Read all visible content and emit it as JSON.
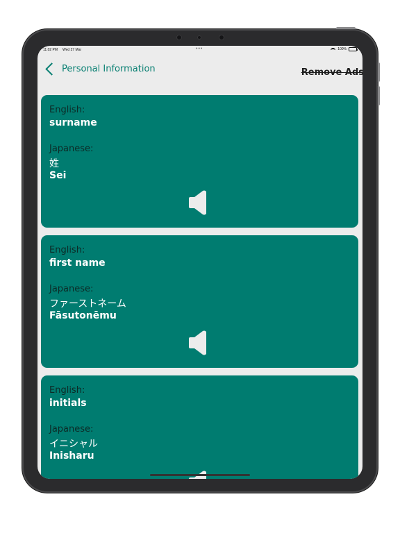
{
  "status_bar": {
    "time": "11:02 PM",
    "date": "Wed 27 Mar",
    "dots": "•••",
    "battery": "100%"
  },
  "header": {
    "title": "Personal Information",
    "remove_ads": "Remove Ads"
  },
  "labels": {
    "english": "English:",
    "japanese": "Japanese:"
  },
  "cards": [
    {
      "english": "surname",
      "japanese": "姓",
      "romaji": "Sei"
    },
    {
      "english": "first name",
      "japanese": "ファーストネーム",
      "romaji": "Fāsutonēmu"
    },
    {
      "english": "initials",
      "japanese": "イニシャル",
      "romaji": "Inisharu"
    }
  ],
  "colors": {
    "accent": "#0a8073",
    "card": "#007c70",
    "background": "#ececec"
  },
  "icons": {
    "back": "chevron-left-icon",
    "speaker": "speaker-icon"
  }
}
